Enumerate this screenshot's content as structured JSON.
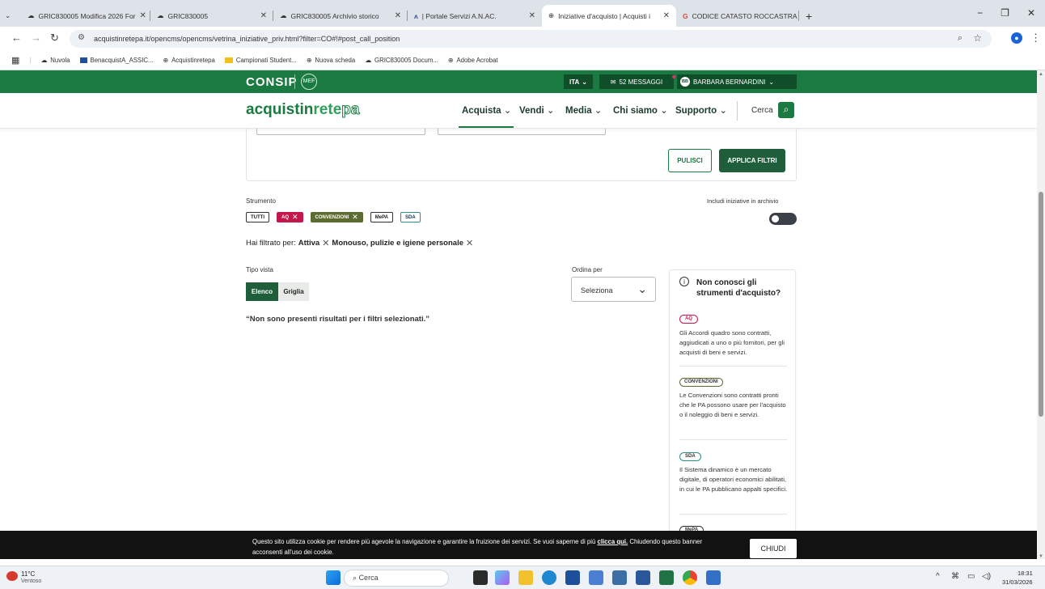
{
  "browser": {
    "tabs": [
      {
        "title": "GRIC830005 Modifica 2026 For",
        "icon": "cloud-icon"
      },
      {
        "title": "GRIC830005",
        "icon": "cloud-icon"
      },
      {
        "title": "GRIC830005 Archivio storico",
        "icon": "cloud-icon"
      },
      {
        "title": "| Portale Servizi A.N.AC.",
        "icon": "anac-icon"
      },
      {
        "title": "Iniziative d'acquisto | Acquisti i",
        "icon": "globe-icon"
      },
      {
        "title": "CODICE CATASTO ROCCASTRA",
        "icon": "google-icon"
      }
    ],
    "url": "acquistinretepa.it/opencms/opencms/vetrina_iniziative_priv.html?filter=CO#!#post_call_position",
    "bookmarks": [
      "Nuvola",
      "BenacquistA_ASSIC...",
      "Acquistinretepa",
      "Campionati Student...",
      "Nuova scheda",
      "GRIC830005 Docum...",
      "Adobe Acrobat"
    ]
  },
  "header": {
    "brand": "CONSIP",
    "mef": "MEF",
    "lang": "ITA",
    "messages": "52 MESSAGGI",
    "user": "BARBARA BERNARDINI",
    "user_initials": "BB"
  },
  "nav": {
    "logo_a": "acquistin",
    "logo_b": "rete",
    "logo_c": "pa",
    "items": [
      "Acquista",
      "Vendi",
      "Media",
      "Chi siamo",
      "Supporto"
    ],
    "search_label": "Cerca"
  },
  "filters": {
    "clear_label": "PULISCI",
    "apply_label": "APPLICA FILTRI",
    "strumento_label": "Strumento",
    "chips": [
      "TUTTI",
      "AQ",
      "CONVENZIONI",
      "MePA",
      "SDA"
    ],
    "archive_label": "Includi iniziative in archivio",
    "filtered_prefix": "Hai filtrato per:",
    "filter_1": "Attiva",
    "filter_2": "Monouso, pulizie e igiene personale"
  },
  "view": {
    "tipo_label": "Tipo vista",
    "elenco": "Elenco",
    "griglia": "Griglia",
    "ordina_label": "Ordina per",
    "select_value": "Seleziona",
    "no_results": "“Non sono presenti risultati per i filtri selezionati.”"
  },
  "info": {
    "title": "Non conosci gli strumenti d'acquisto?",
    "items": [
      {
        "badge": "AQ",
        "text": "Gli Accordi quadro sono contratti, aggiudicati a uno o più fornitori, per gli acquisti di beni e servizi."
      },
      {
        "badge": "CONVENZIONI",
        "text": "Le Convenzioni sono contratti pronti che le PA possono usare per l'acquisto o il noleggio di beni e servizi."
      },
      {
        "badge": "SDA",
        "text": "Il Sistema dinamico è un mercato digitale, di operatori economici abilitati, in cui le PA pubblicano appalti specifici."
      },
      {
        "badge": "MePA",
        "text": ""
      }
    ]
  },
  "cookie": {
    "text_a": "Questo sito utilizza cookie per rendere più agevole la navigazione e garantire la fruizione dei servizi. Se vuoi saperne di più ",
    "link": "clicca qui.",
    "text_b": " Chiudendo questo banner",
    "line2": "acconsenti all'uso dei cookie.",
    "close": "CHIUDI"
  },
  "taskbar": {
    "temp": "11°C",
    "weather": "Ventoso",
    "search": "Cerca",
    "time": "18:31",
    "date": "31/03/2026"
  },
  "colors": {
    "green": "#1a7a42",
    "dark_green": "#1f5e3a",
    "aq": "#c4174b",
    "conv": "#5c6b2f"
  }
}
